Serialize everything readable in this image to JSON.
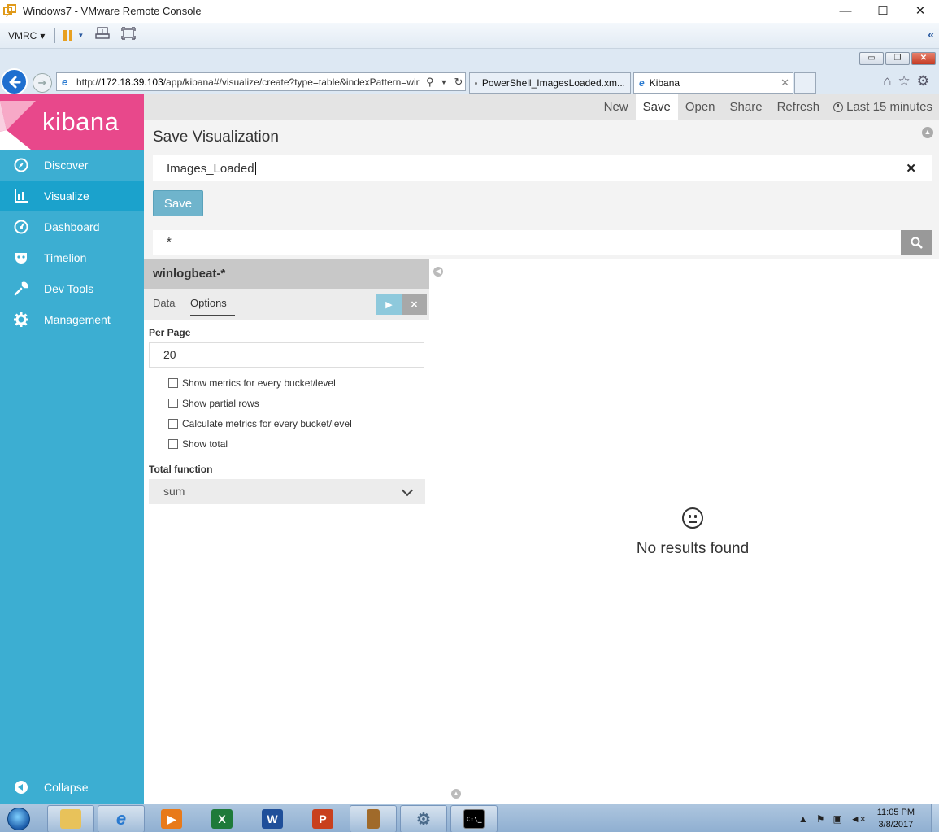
{
  "window": {
    "title": "Windows7 - VMware Remote Console",
    "minimize": "—",
    "maximize": "☐",
    "close": "✕"
  },
  "vm_toolbar": {
    "menu_label": "VMRC",
    "menu_caret": "▾"
  },
  "browser": {
    "url_prefix": "http://",
    "url_host": "172.18.39.103",
    "url_path": "/app/kibana#/visualize/create?type=table&indexPattern=wir",
    "tabs": [
      {
        "label": "PowerShell_ImagesLoaded.xm...",
        "active": false
      },
      {
        "label": "Kibana",
        "active": true
      }
    ],
    "tab_close": "✕"
  },
  "kibana": {
    "logo_text": "kibana",
    "nav": [
      {
        "label": "Discover",
        "icon": "compass-icon"
      },
      {
        "label": "Visualize",
        "icon": "bar-chart-icon",
        "active": true
      },
      {
        "label": "Dashboard",
        "icon": "dashboard-gauge-icon"
      },
      {
        "label": "Timelion",
        "icon": "timelion-mask-icon"
      },
      {
        "label": "Dev Tools",
        "icon": "wrench-icon"
      },
      {
        "label": "Management",
        "icon": "gear-icon"
      }
    ],
    "collapse_label": "Collapse",
    "topnav": {
      "new": "New",
      "save": "Save",
      "open": "Open",
      "share": "Share",
      "refresh": "Refresh",
      "time_range": "Last 15 minutes"
    },
    "save_panel": {
      "title": "Save Visualization",
      "input_value": "Images_Loaded",
      "save_button": "Save"
    },
    "query": {
      "value": "*"
    },
    "editor": {
      "index_pattern": "winlogbeat-*",
      "tabs": [
        "Data",
        "Options"
      ],
      "active_tab": "Options",
      "per_page_label": "Per Page",
      "per_page_value": "20",
      "checkboxes": [
        {
          "label": "Show metrics for every bucket/level",
          "checked": false
        },
        {
          "label": "Show partial rows",
          "checked": false
        },
        {
          "label": "Calculate metrics for every bucket/level",
          "checked": false
        },
        {
          "label": "Show total",
          "checked": false
        }
      ],
      "total_function_label": "Total function",
      "total_function_value": "sum"
    },
    "results": {
      "empty_text": "No results found"
    }
  },
  "taskbar": {
    "clock_time": "11:05 PM",
    "clock_date": "3/8/2017"
  },
  "colors": {
    "sidebar": "#3caed2",
    "sidebar_active": "#1ba2cc",
    "logo_bg": "#e8488b",
    "save_button": "#6fb4cc",
    "topnav_bg": "#e4e4e4"
  }
}
